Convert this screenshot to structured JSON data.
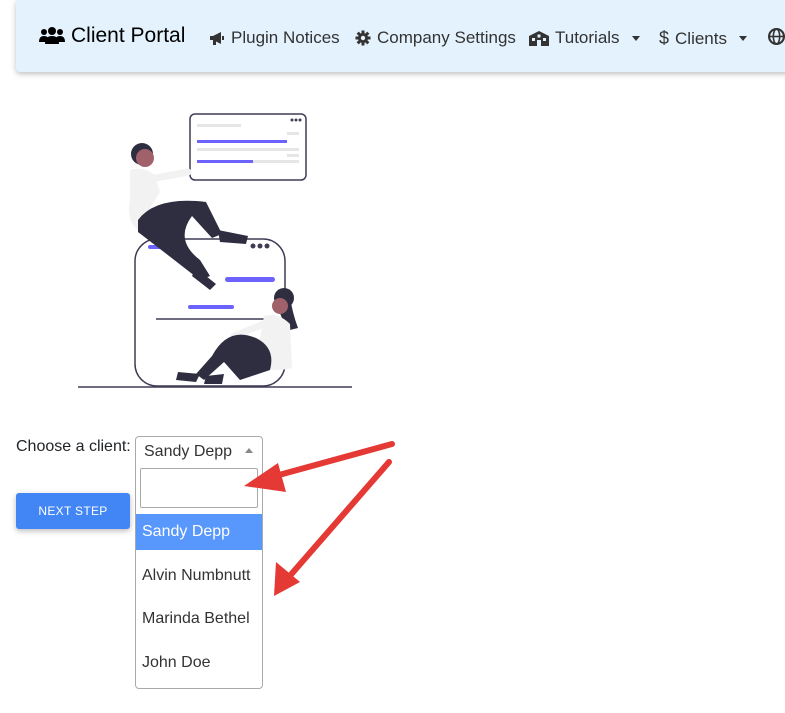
{
  "nav": {
    "brand": "Client Portal",
    "items": [
      {
        "label": "Plugin Notices",
        "icon": "bullhorn-icon",
        "dropdown": false
      },
      {
        "label": "Company Settings",
        "icon": "gear-icon",
        "dropdown": false
      },
      {
        "label": "Tutorials",
        "icon": "building-icon",
        "dropdown": true
      },
      {
        "label": "Clients",
        "icon": "dollar-icon",
        "dropdown": true
      }
    ],
    "overflow_icon": "globe-icon"
  },
  "form": {
    "label": "Choose a client:",
    "selected_value": "Sandy Depp",
    "search_value": "",
    "options": [
      "Sandy Depp",
      "Alvin Numbnutt",
      "Marinda Bethel",
      "John Doe"
    ],
    "next_button": "NEXT STEP"
  },
  "colors": {
    "navbar_bg": "#e3f2fd",
    "button": "#4285f4",
    "highlight": "#5897fb",
    "annotation_arrow": "#e53935",
    "illustration_accent": "#6c63ff",
    "illustration_dark": "#2f2e41"
  }
}
